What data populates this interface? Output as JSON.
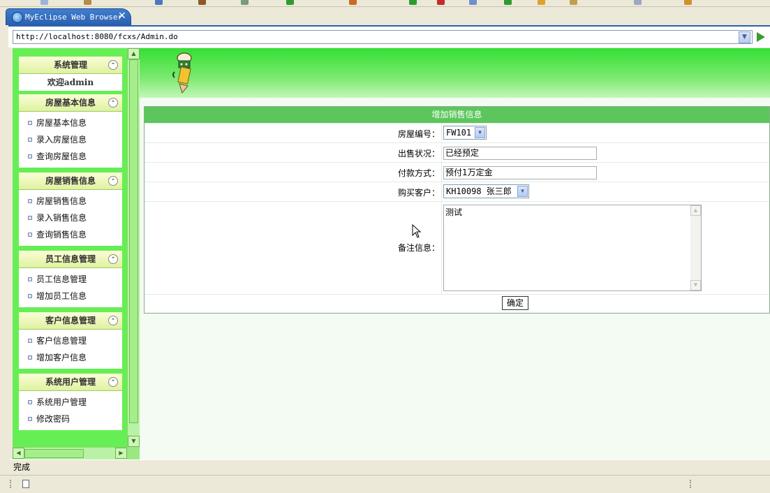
{
  "browser": {
    "tab_title": "MyEclipse Web Browser",
    "close_glyph": "✕",
    "url": "http://localhost:8080/fcxs/Admin.do",
    "status": "完成"
  },
  "sidebar": {
    "panels": [
      {
        "title": "系统管理",
        "welcome": "欢迎admin",
        "items": []
      },
      {
        "title": "房屋基本信息",
        "items": [
          "房屋基本信息",
          "录入房屋信息",
          "查询房屋信息"
        ]
      },
      {
        "title": "房屋销售信息",
        "items": [
          "房屋销售信息",
          "录入销售信息",
          "查询销售信息"
        ]
      },
      {
        "title": "员工信息管理",
        "items": [
          "员工信息管理",
          "增加员工信息"
        ]
      },
      {
        "title": "客户信息管理",
        "items": [
          "客户信息管理",
          "增加客户信息"
        ]
      },
      {
        "title": "系统用户管理",
        "items": [
          "系统用户管理",
          "修改密码"
        ]
      }
    ]
  },
  "form": {
    "title": "增加销售信息",
    "house_label": "房屋编号：",
    "house_value": "FW101",
    "status_label": "出售状况：",
    "status_value": "已经预定",
    "payment_label": "付款方式：",
    "payment_value": "预付1万定金",
    "customer_label": "购买客户：",
    "customer_value": "KH10098 张三郎",
    "notes_label": "备注信息：",
    "notes_value": "测试",
    "submit_label": "确定"
  },
  "icons": {
    "tab": "globe-icon",
    "go": "go-arrow-icon",
    "collapse": "collapse-up-icon",
    "banner": "pencil-mascot-icon",
    "pointer": "mouse-cursor-icon"
  },
  "colors": {
    "sidebar_bg": "#66ee55",
    "form_header": "#5cc65c",
    "tab_blue": "#2a5fae"
  }
}
